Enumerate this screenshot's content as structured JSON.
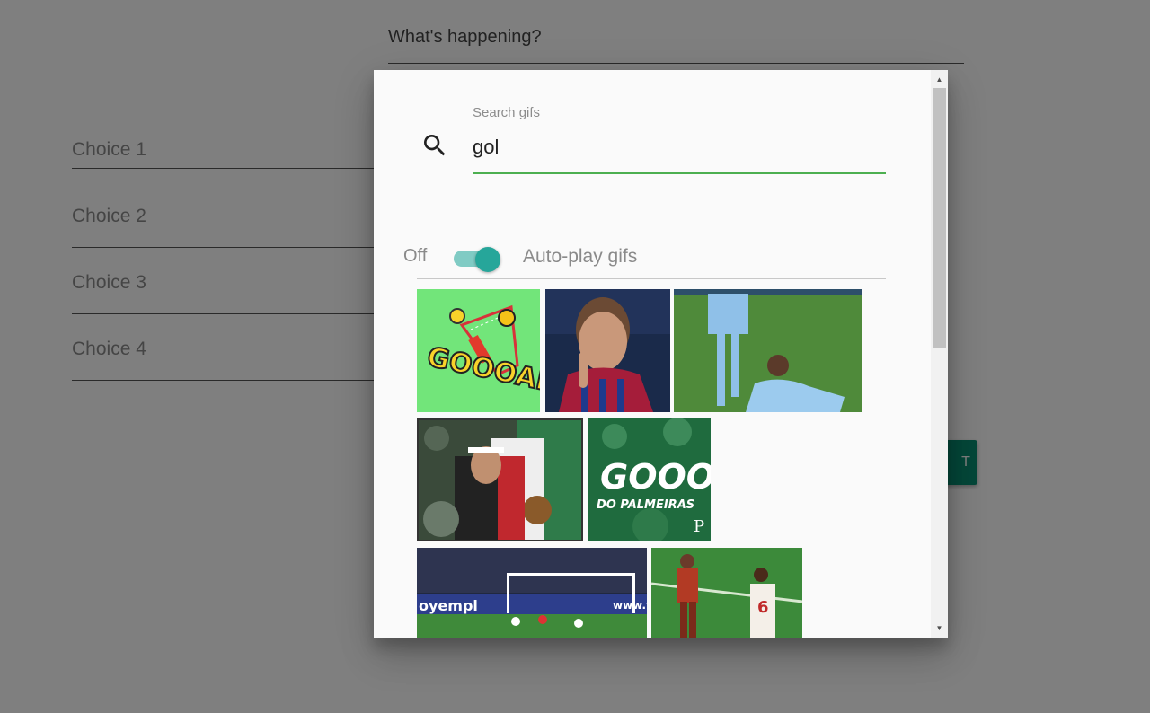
{
  "compose": {
    "placeholder": "What's happening?"
  },
  "choices": [
    {
      "label": "Choice 1"
    },
    {
      "label": "Choice 2"
    },
    {
      "label": "Choice 3"
    },
    {
      "label": "Choice 4"
    }
  ],
  "submit": {
    "label": "T"
  },
  "gif_dialog": {
    "search": {
      "label": "Search gifs",
      "value": "gol",
      "icon": "search-icon"
    },
    "autoplay": {
      "off_label": "Off",
      "label": "Auto-play gifs",
      "enabled": true
    },
    "gifs": [
      {
        "id": "gif-1",
        "caption": "GOOOALL!!"
      },
      {
        "id": "gif-2"
      },
      {
        "id": "gif-3"
      },
      {
        "id": "gif-4"
      },
      {
        "id": "gif-5",
        "caption": "GOOOL",
        "subcaption": "DO PALMEIRAS"
      },
      {
        "id": "gif-6",
        "caption": "oyempl",
        "subcaption": "www.yo"
      },
      {
        "id": "gif-7",
        "caption": "6"
      }
    ]
  },
  "colors": {
    "accent_green": "#4caf50",
    "toggle_knob": "#26a69a",
    "toggle_track": "#80cbc4",
    "submit_button": "#0a8f73"
  }
}
